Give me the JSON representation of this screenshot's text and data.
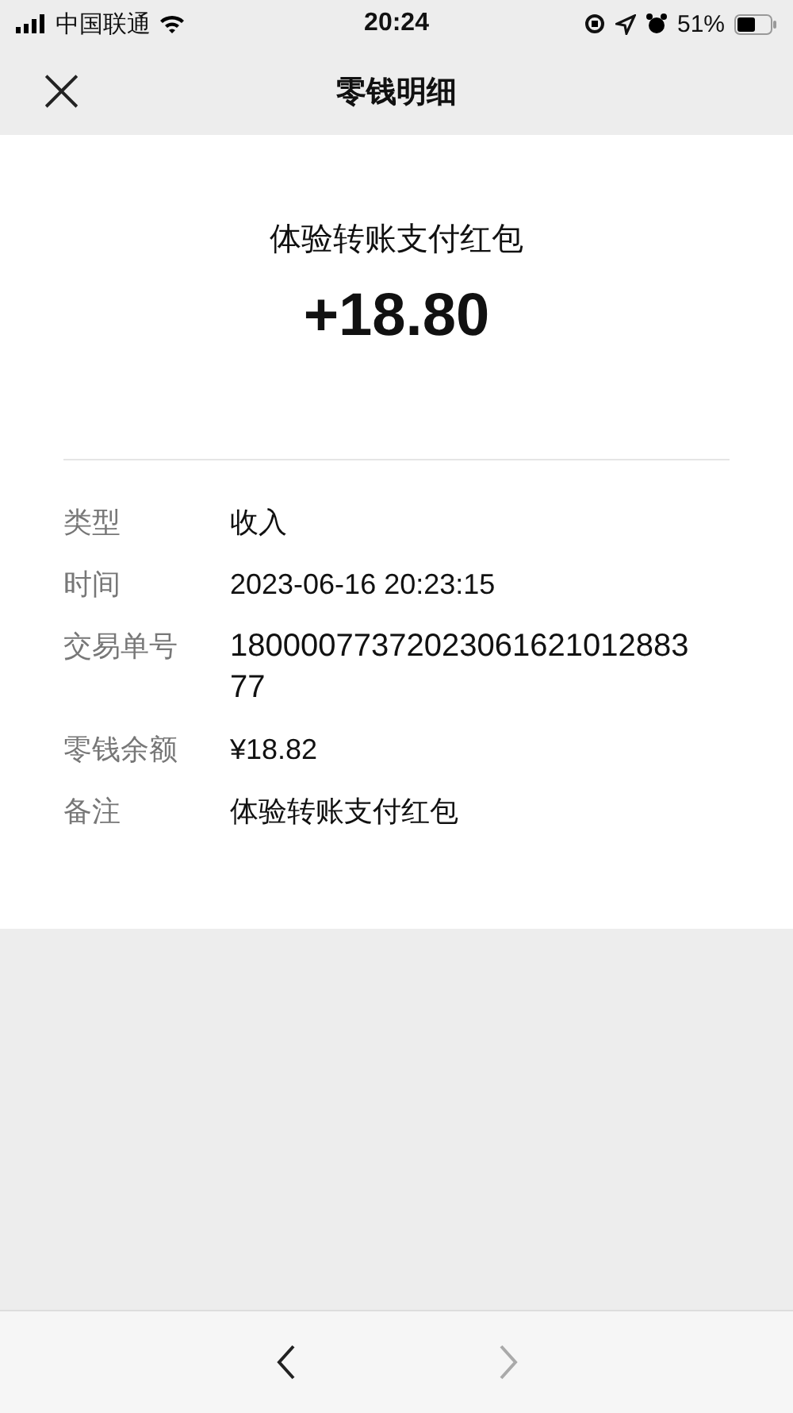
{
  "status_bar": {
    "carrier": "中国联通",
    "time": "20:24",
    "battery": "51%"
  },
  "nav": {
    "close_icon": "×",
    "title": "零钱明细"
  },
  "summary": {
    "title": "体验转账支付红包",
    "amount": "+18.80"
  },
  "details": [
    {
      "label": "类型",
      "value": "收入"
    },
    {
      "label": "时间",
      "value": "2023-06-16 20:23:15"
    },
    {
      "label": "交易单号",
      "value": "1800007737202306162101288377"
    },
    {
      "label": "零钱余额",
      "value": "¥18.82"
    },
    {
      "label": "备注",
      "value": "体验转账支付红包"
    }
  ],
  "toolbar": [
    {
      "kind": "back",
      "disabled": false
    },
    {
      "kind": "forward",
      "disabled": true
    }
  ]
}
